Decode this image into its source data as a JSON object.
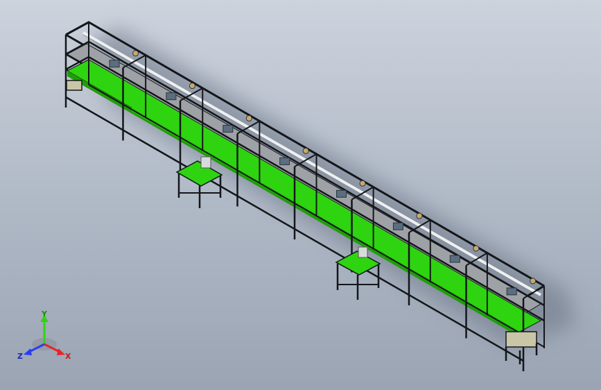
{
  "colors": {
    "frame": "#14161a",
    "belt": "#2fd411",
    "belt_dark": "#1f9e0a",
    "plate": "#9ea2a6",
    "plate_dark": "#7f8489",
    "bench_top": "#2fd411",
    "axis_x": "#e8242a",
    "axis_y": "#2fd411",
    "axis_z": "#2a3cf2"
  },
  "triad": {
    "x_label": "X",
    "y_label": "Y",
    "z_label": "Z"
  }
}
